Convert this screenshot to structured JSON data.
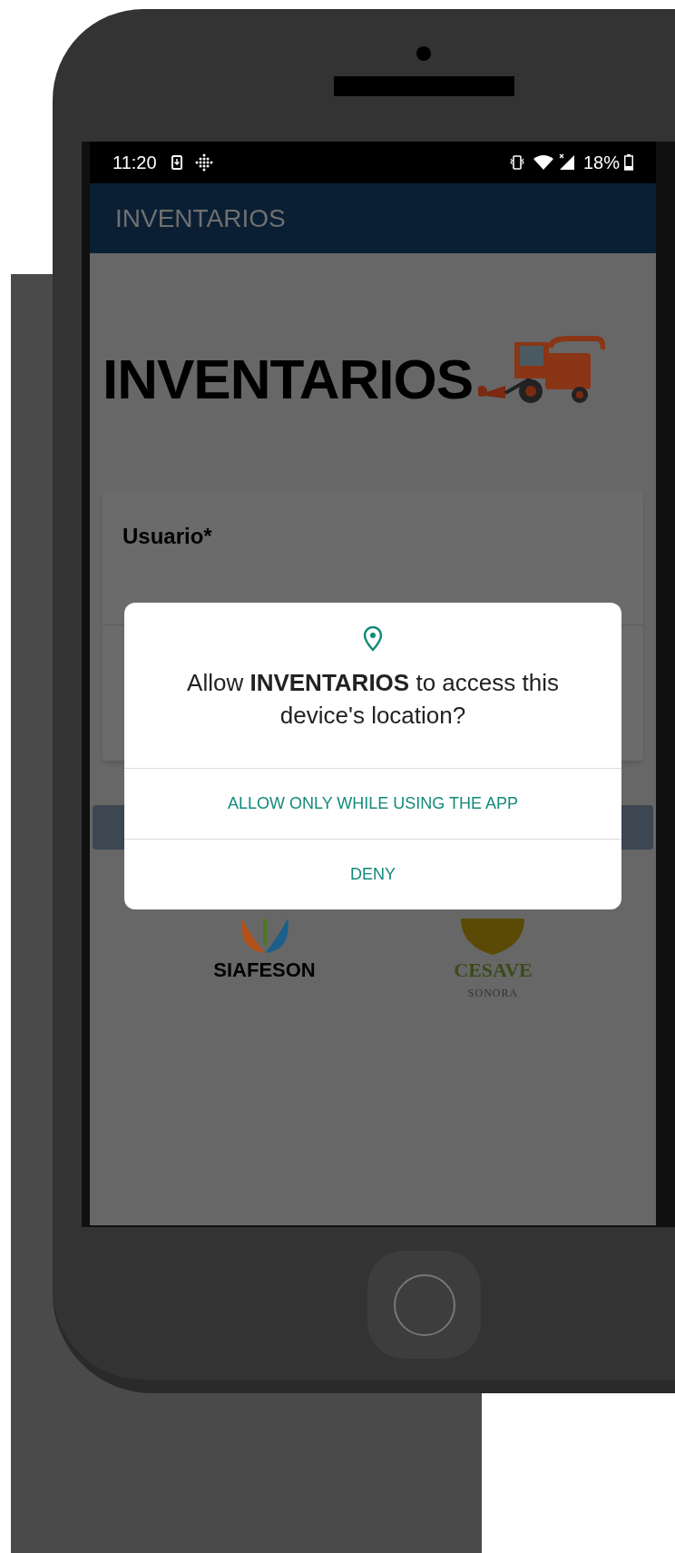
{
  "status_bar": {
    "time": "11:20",
    "battery": "18%"
  },
  "app_bar": {
    "title": "INVENTARIOS"
  },
  "logo": {
    "text": "INVENTARIOS"
  },
  "form": {
    "fields": [
      {
        "label": "Usuario*"
      }
    ]
  },
  "partner_logos": [
    {
      "name": "SIAFESON"
    },
    {
      "name": "CESAVE",
      "subtitle": "SONORA"
    }
  ],
  "dialog": {
    "message": "Allow **INVENTARIOS** to access this device's location?",
    "buttons": [
      "ALLOW ONLY WHILE USING THE APP",
      "DENY"
    ]
  }
}
